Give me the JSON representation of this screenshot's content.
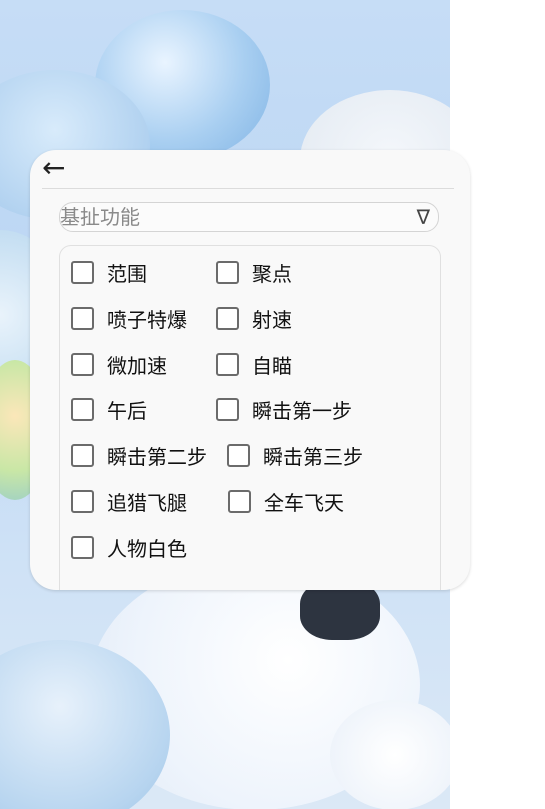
{
  "panel": {
    "back_icon": "back-arrow-icon",
    "back_glyph": "←",
    "dropdown": {
      "value": "基扯功能",
      "caret": "∇"
    },
    "options": [
      {
        "label": "范围",
        "checked": false
      },
      {
        "label": "聚点",
        "checked": false
      },
      {
        "label": "喷子特爆",
        "checked": false
      },
      {
        "label": "射速",
        "checked": false
      },
      {
        "label": "微加速",
        "checked": false
      },
      {
        "label": "自瞄",
        "checked": false
      },
      {
        "label": "午后",
        "checked": false
      },
      {
        "label": "瞬击第一步",
        "checked": false
      },
      {
        "label": "瞬击第二步",
        "checked": false
      },
      {
        "label": "瞬击第三步",
        "checked": false
      },
      {
        "label": "追猎飞腿",
        "checked": false
      },
      {
        "label": "全车飞天",
        "checked": false
      },
      {
        "label": "人物白色",
        "checked": false
      }
    ]
  }
}
